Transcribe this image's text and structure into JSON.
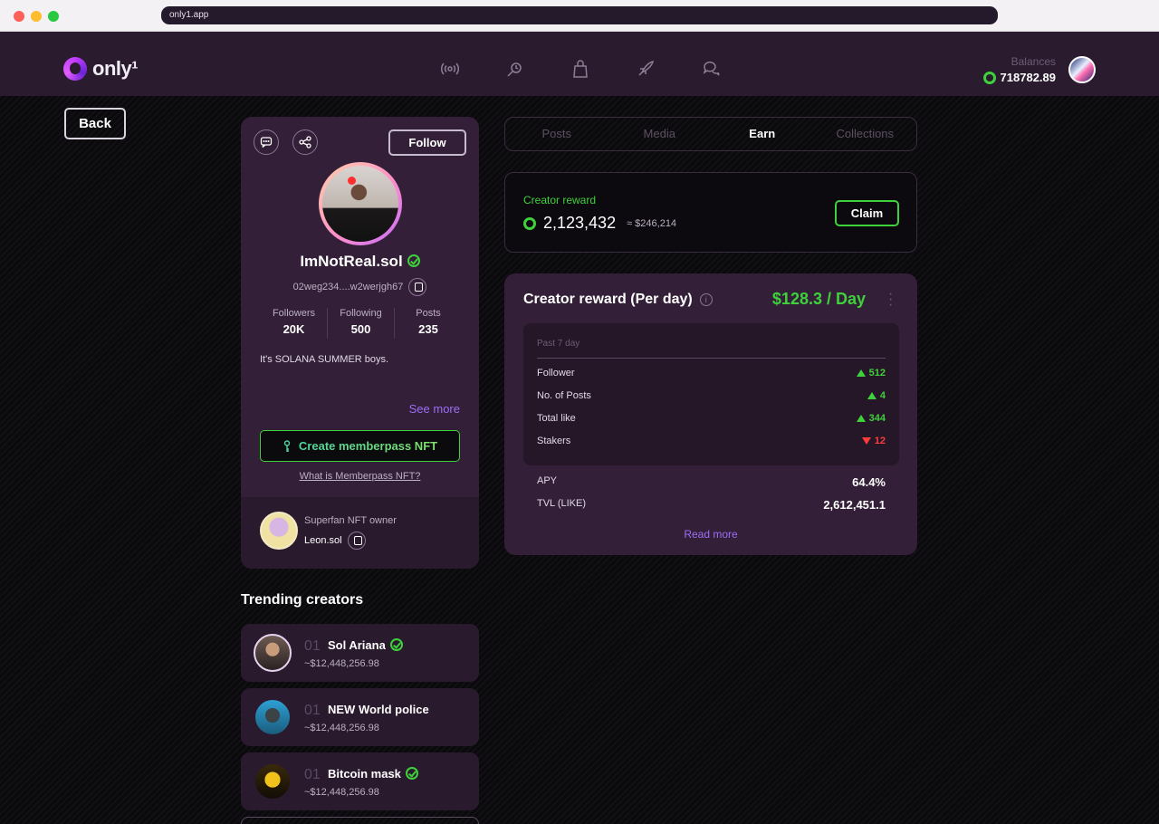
{
  "browser": {
    "url": "only1.app"
  },
  "header": {
    "logo_text": "only¹",
    "nav": [
      "broadcast-icon",
      "rocket-search-icon",
      "bag-icon",
      "rocket-icon",
      "chat-icon"
    ],
    "balances_label": "Balances",
    "balances_value": "718782.89"
  },
  "back_label": "Back",
  "profile": {
    "follow_label": "Follow",
    "name": "ImNotReal.sol",
    "address": "02weg234....w2werjgh67",
    "stats": [
      {
        "label": "Followers",
        "value": "20K"
      },
      {
        "label": "Following",
        "value": "500"
      },
      {
        "label": "Posts",
        "value": "235"
      }
    ],
    "bio": "It's SOLANA SUMMER boys.",
    "see_more": "See more",
    "create_label": "Create memberpass NFT",
    "what_link": "What is Memberpass NFT?",
    "owner_label": "Superfan NFT owner",
    "owner_name": "Leon.sol"
  },
  "trending": {
    "title": "Trending creators",
    "items": [
      {
        "rank": "01",
        "name": "Sol Ariana",
        "value": "~$12,448,256.98",
        "verified": true
      },
      {
        "rank": "01",
        "name": "NEW World police",
        "value": "~$12,448,256.98",
        "verified": false
      },
      {
        "rank": "01",
        "name": "Bitcoin mask",
        "value": "~$12,448,256.98",
        "verified": true
      }
    ]
  },
  "tabs": [
    "Posts",
    "Media",
    "Earn",
    "Collections"
  ],
  "reward": {
    "label": "Creator reward",
    "amount": "2,123,432",
    "approx": "≈ $246,214",
    "claim_label": "Claim"
  },
  "perday": {
    "title": "Creator reward (Per day)",
    "value": "$128.3 / Day",
    "period": "Past 7 day",
    "metrics": [
      {
        "label": "Follower",
        "value": "512",
        "trend": "up"
      },
      {
        "label": "No. of Posts",
        "value": "4",
        "trend": "up"
      },
      {
        "label": "Total like",
        "value": "344",
        "trend": "up"
      },
      {
        "label": "Stakers",
        "value": "12",
        "trend": "down"
      }
    ],
    "apy_label": "APY",
    "apy_value": "64.4%",
    "tvl_label": "TVL (LIKE)",
    "tvl_value": "2,612,451.1",
    "read_more": "Read more"
  },
  "colors": {
    "accent_green": "#3fd13c",
    "accent_purple": "#9c6ef6",
    "down_red": "#ff3b3b",
    "card_bg": "#331f37"
  }
}
